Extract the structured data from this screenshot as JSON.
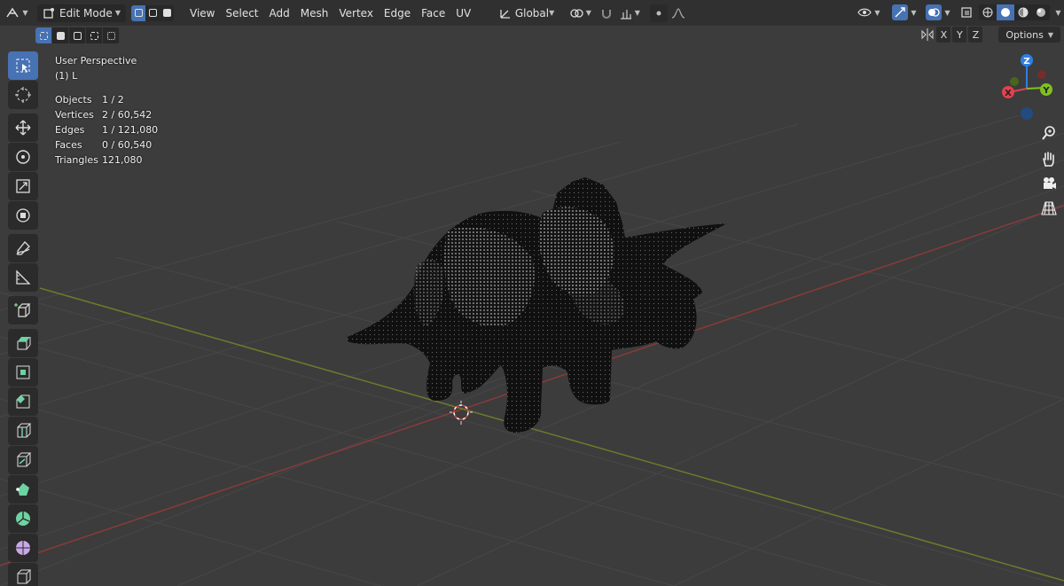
{
  "header": {
    "mode": "Edit Mode",
    "menu": [
      "View",
      "Select",
      "Add",
      "Mesh",
      "Vertex",
      "Edge",
      "Face",
      "UV"
    ],
    "transform_orientation": "Global",
    "accent_color": "#4772b3"
  },
  "axis_buttons": [
    "X",
    "Y",
    "Z"
  ],
  "options_label": "Options",
  "overlay": {
    "view_name": "User Perspective",
    "object_name": "(1) L",
    "stats": [
      {
        "label": "Objects",
        "value": "1 / 2"
      },
      {
        "label": "Vertices",
        "value": "2 / 60,542"
      },
      {
        "label": "Edges",
        "value": "1 / 121,080"
      },
      {
        "label": "Faces",
        "value": "0 / 60,540"
      },
      {
        "label": "Triangles",
        "value": "121,080"
      }
    ]
  },
  "gizmo": {
    "x": "X",
    "y": "Y",
    "z": "Z",
    "x_color": "#e0424f",
    "y_color": "#7ec11f",
    "z_color": "#2f7fe3"
  },
  "tools": [
    {
      "name": "select-box-icon",
      "active": true
    },
    {
      "name": "cursor-icon"
    },
    {
      "name": "move-icon"
    },
    {
      "name": "rotate-icon"
    },
    {
      "name": "scale-icon"
    },
    {
      "name": "transform-icon"
    },
    {
      "name": "annotate-icon"
    },
    {
      "name": "measure-icon"
    },
    {
      "name": "add-cube-icon"
    },
    {
      "name": "extrude-region-icon"
    },
    {
      "name": "inset-faces-icon"
    },
    {
      "name": "bevel-icon"
    },
    {
      "name": "loop-cut-icon"
    },
    {
      "name": "knife-icon"
    },
    {
      "name": "poly-build-icon"
    },
    {
      "name": "spin-icon"
    },
    {
      "name": "smooth-icon"
    },
    {
      "name": "edge-slide-icon"
    }
  ]
}
